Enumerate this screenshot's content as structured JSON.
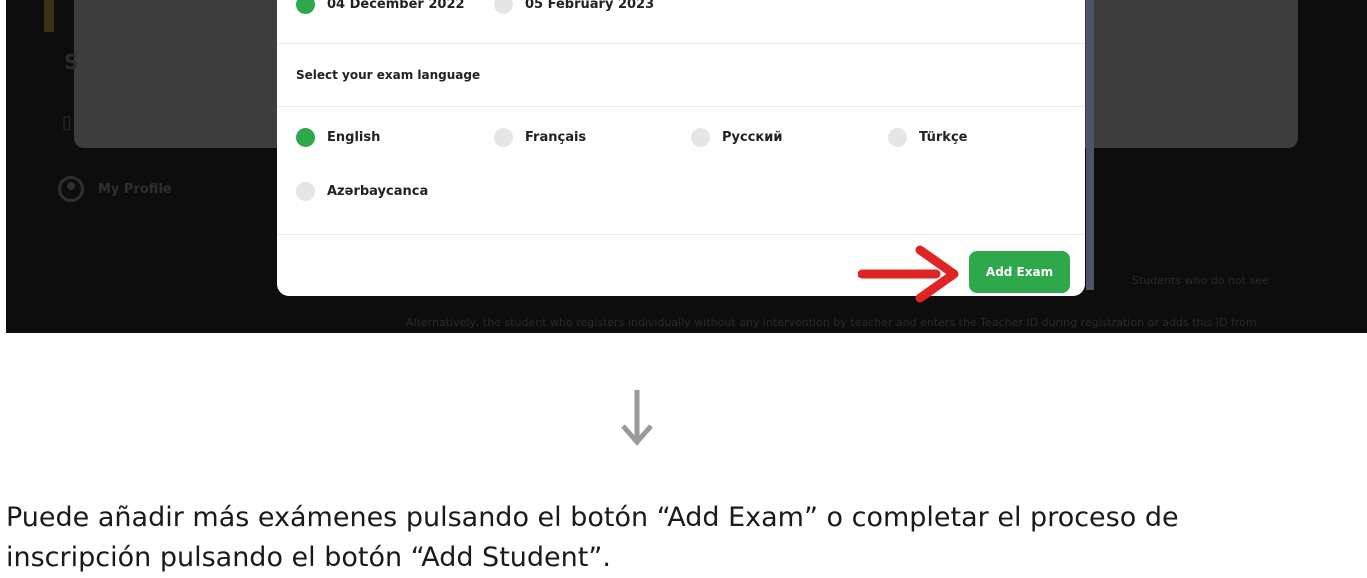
{
  "dates": [
    {
      "label": "04 December 2022",
      "selected": true
    },
    {
      "label": "05 February 2023",
      "selected": false
    }
  ],
  "language_section": {
    "title": "Select your exam language"
  },
  "languages": [
    {
      "label": "English",
      "selected": true
    },
    {
      "label": "Français",
      "selected": false
    },
    {
      "label": "Русский",
      "selected": false
    },
    {
      "label": "Türkçe",
      "selected": false
    },
    {
      "label": "Azərbaycanca",
      "selected": false
    }
  ],
  "add_exam_button": "Add Exam",
  "background": {
    "profile_label": "My Profile",
    "note_1": "Students who do not see",
    "note_2": "Alternatively, the student who registers individually without any intervention by teacher and enters the Teacher ID during registration or adds this ID from"
  },
  "caption": {
    "line1": "Puede añadir más exámenes pulsando el botón “Add Exam” o completar el proceso de",
    "line2": "inscripción pulsando el botón “Add Student”."
  },
  "colors": {
    "accent": "#2ea84a",
    "annotation_arrow": "#e02424",
    "overlay": "#0d0d0d"
  }
}
